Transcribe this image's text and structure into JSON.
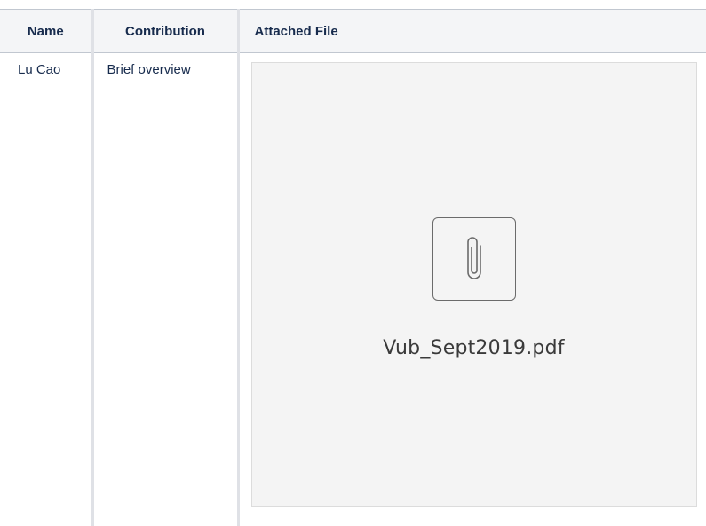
{
  "table": {
    "headers": {
      "name": "Name",
      "contribution": "Contribution",
      "attached_file": "Attached File"
    },
    "rows": [
      {
        "name": "Lu Cao",
        "contribution": "Brief overview",
        "attachment": {
          "icon": "paperclip-icon",
          "filename": "Vub_Sept2019.pdf"
        }
      }
    ]
  },
  "colors": {
    "header_bg": "#f4f5f7",
    "grid_line": "#c1c7d0",
    "card_bg": "#f4f4f4"
  }
}
